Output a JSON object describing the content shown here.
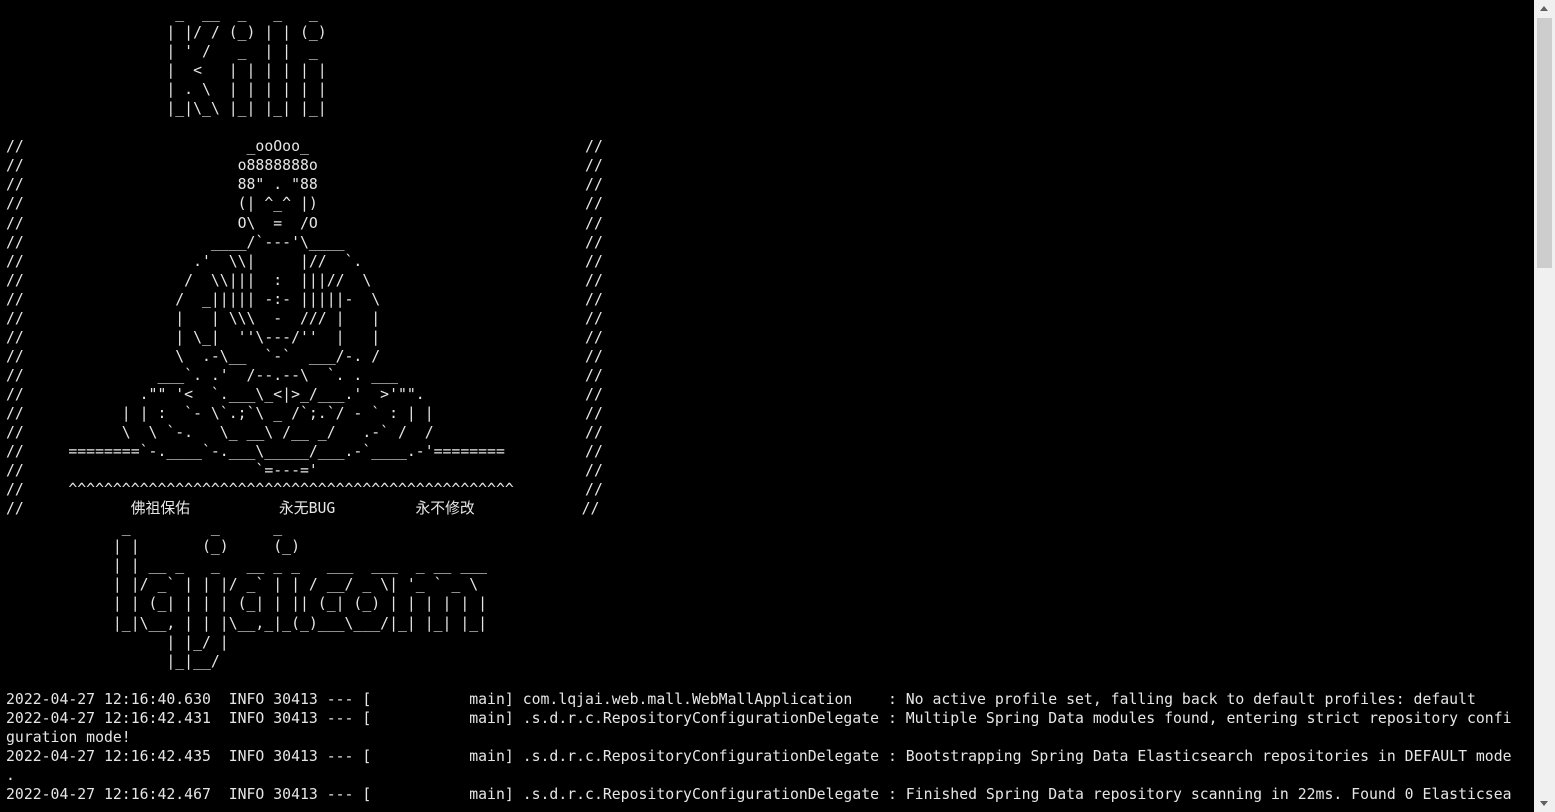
{
  "terminal": {
    "lines": [
      "                   _  __  _   _   _",
      "                  | |/ / (_) | | (_)",
      "                  | ' /   _  | |  _",
      "                  |  <   | | | | | |",
      "                  | . \\  | | | | | |",
      "                  |_|\\_\\ |_| |_| |_|",
      "",
      "//                         _ooOoo_                               //",
      "//                        o8888888o                              //",
      "//                        88\" . \"88                              //",
      "//                        (| ^_^ |)                              //",
      "//                        O\\  =  /O                              //",
      "//                     ____/`---'\\____                           //",
      "//                   .'  \\\\|     |//  `.                         //",
      "//                  /  \\\\|||  :  |||//  \\                        //",
      "//                 /  _||||| -:- |||||-  \\                       //",
      "//                 |   | \\\\\\  -  /// |   |                       //",
      "//                 | \\_|  ''\\---/''  |   |                       //",
      "//                 \\  .-\\__  `-`  ___/-. /                       //",
      "//               ___`. .'  /--.--\\  `. . ___                     //",
      "//             .\"\" '<  `.___\\_<|>_/___.'  >'\"\".                  //",
      "//           | | :  `- \\`.;`\\ _ /`;.`/ - ` : | |                 //",
      "//           \\  \\ `-.   \\_ __\\ /__ _/   .-` /  /                 //",
      "//     ========`-.____`-.___\\_____/___.-`____.-'========         //",
      "//                          `=---='                              //",
      "//     ^^^^^^^^^^^^^^^^^^^^^^^^^^^^^^^^^^^^^^^^^^^^^^^^^^        //",
      "//            佛祖保佑          永无BUG         永不修改            //",
      "             _         _      _",
      "            | |       (_)     (_)",
      "            | | __ _   _   __ _ _   ___  ___  _ __ ___",
      "            | |/ _` | | |/ _` | | / __/ _ \\| '_ ` _ \\",
      "            | | (_| | | | (_| | || (_| (_) | | | | | |",
      "            |_|\\__, | | |\\__,_|_(_)___\\___/|_| |_| |_|",
      "                  | |_/ |",
      "                  |_|__/",
      "",
      "2022-04-27 12:16:40.630  INFO 30413 --- [           main] com.lqjai.web.mall.WebMallApplication    : No active profile set, falling back to default profiles: default",
      "2022-04-27 12:16:42.431  INFO 30413 --- [           main] .s.d.r.c.RepositoryConfigurationDelegate : Multiple Spring Data modules found, entering strict repository confi",
      "guration mode!",
      "2022-04-27 12:16:42.435  INFO 30413 --- [           main] .s.d.r.c.RepositoryConfigurationDelegate : Bootstrapping Spring Data Elasticsearch repositories in DEFAULT mode",
      ".",
      "2022-04-27 12:16:42.467  INFO 30413 --- [           main] .s.d.r.c.RepositoryConfigurationDelegate : Finished Spring Data repository scanning in 22ms. Found 0 Elasticsea"
    ]
  }
}
